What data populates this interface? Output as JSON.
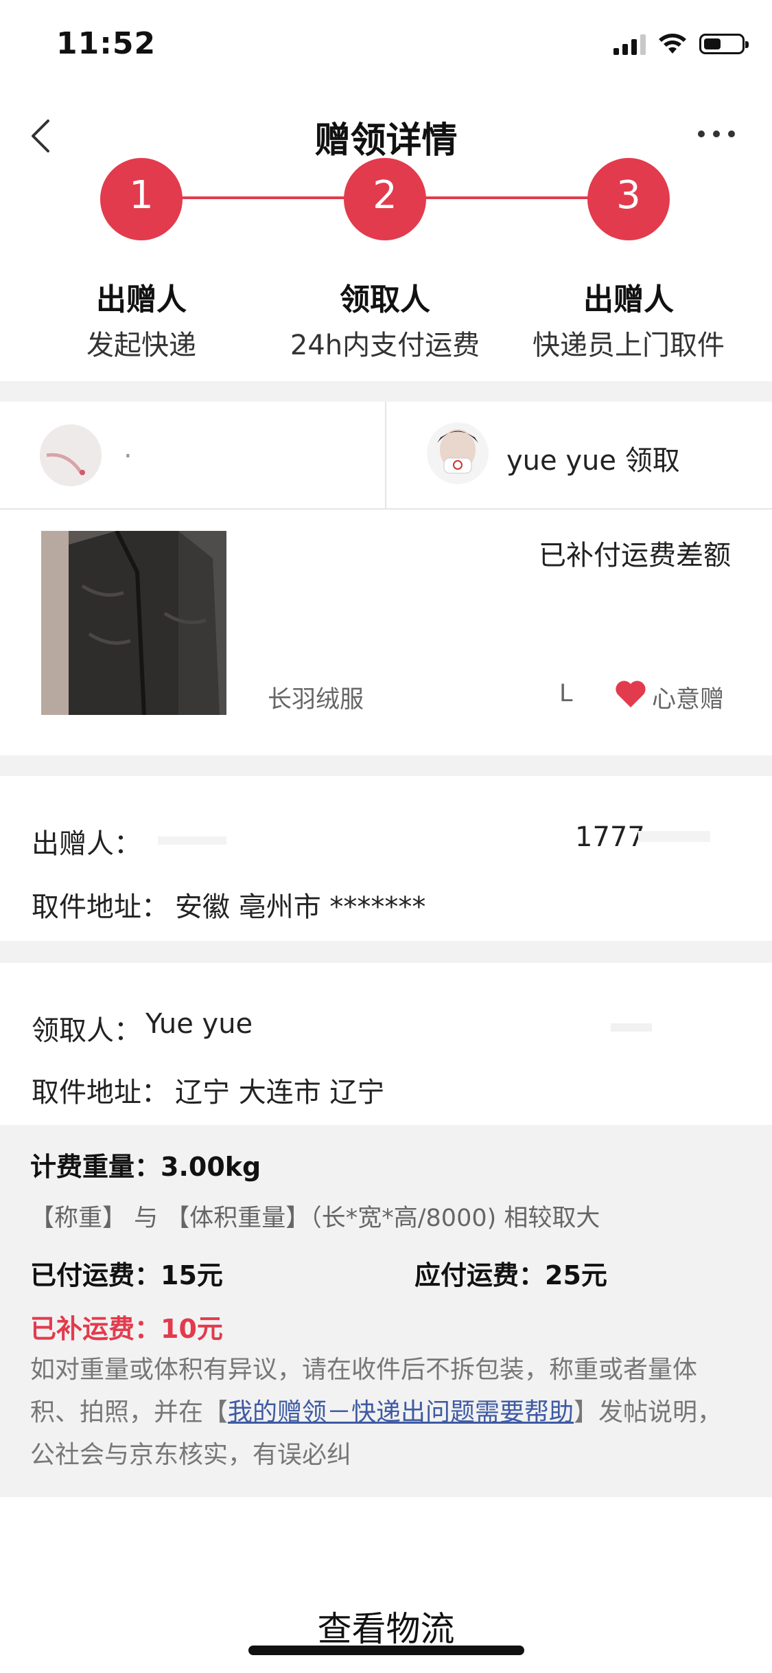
{
  "status_bar": {
    "time": "11:52"
  },
  "header": {
    "title": "赠领详情"
  },
  "steps": [
    {
      "number": "1",
      "title": "出赠人",
      "desc": "发起快递"
    },
    {
      "number": "2",
      "title": "领取人",
      "desc": "24h内支付运费"
    },
    {
      "number": "3",
      "title": "出赠人",
      "desc": "快递员上门取件"
    }
  ],
  "parties": {
    "giver_name": ".",
    "receiver_label": "yue yue 领取"
  },
  "item": {
    "status": "已补付运费差额",
    "name": "长羽绒服",
    "size": "L",
    "tag": "心意赠"
  },
  "giver_section": {
    "label": "出赠人：",
    "phone": "1777",
    "address_label": "取件地址：",
    "address": "安徽 亳州市 *******"
  },
  "receiver_section": {
    "label": "领取人：",
    "name": "Yue yue",
    "address_label": "取件地址：",
    "address": "辽宁 大连市 辽宁"
  },
  "fees": {
    "weight": "计费重量：3.00kg",
    "rule": "【称重】 与 【体积重量】（长*宽*高/8000) 相较取大",
    "paid": "已付运费：15元",
    "due": "应付运费：25元",
    "supplemented": "已补运费：10元",
    "note_before": "如对重量或体积有异议，请在收件后不拆包装，称重或者量体积、拍照，并在【",
    "note_link": "我的赠领－快递出问题需要帮助",
    "note_after": "】发帖说明，公社会与京东核实，有误必纠"
  },
  "actions": {
    "view_logistics": "查看物流"
  },
  "colors": {
    "accent": "#e23b4d",
    "link": "#3e5aa3",
    "band": "#f2f2f2"
  }
}
